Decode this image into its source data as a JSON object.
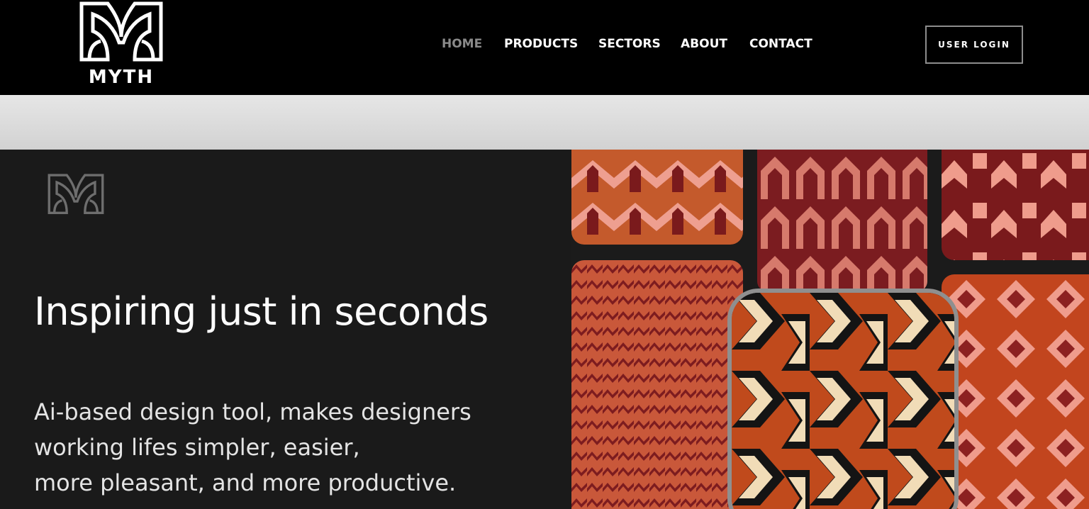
{
  "brand": {
    "name": "MYTH"
  },
  "nav": {
    "items": [
      {
        "label": "HOME",
        "active": true
      },
      {
        "label": "PRODUCTS",
        "active": false
      },
      {
        "label": "SECTORS",
        "active": false
      },
      {
        "label": "ABOUT",
        "active": false
      },
      {
        "label": "CONTACT",
        "active": false
      }
    ],
    "login_label": "USER LOGIN"
  },
  "hero": {
    "title": "Inspiring just in seconds",
    "subtitle_lines": [
      "Ai-based design tool, makes designers",
      "working lifes simpler, easier,",
      "more pleasant, and more productive."
    ]
  },
  "colors": {
    "header_bg": "#000000",
    "hero_bg": "#1a1a1a",
    "active_nav": "#8a8a8a",
    "pattern_rust": "#c04a1c",
    "pattern_maroon": "#7a1a1c",
    "pattern_pink": "#e89a88",
    "pattern_cream": "#f1dcb7"
  },
  "icons": [
    "myth-logo-icon",
    "myth-monogram-icon"
  ]
}
